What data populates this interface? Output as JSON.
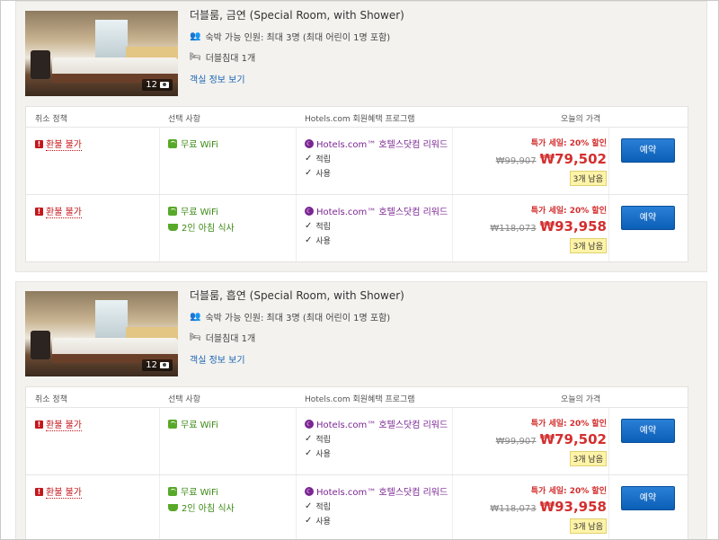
{
  "rooms": [
    {
      "title": "더블룸, 금연 (Special Room, with Shower)",
      "occupancy": "숙박 가능 인원: 최대 3명 (최대 어린이 1명 포함)",
      "bed": "더블침대 1개",
      "details_link": "객실 정보 보기",
      "photo_count": "12",
      "headers": {
        "policy": "취소 정책",
        "choices": "선택 사항",
        "program": "Hotels.com 회원혜택 프로그램",
        "price": "오늘의 가격"
      },
      "rates": [
        {
          "policy": "환불 불가",
          "choices": [
            "무료 WiFi"
          ],
          "program": "Hotels.com™ 호텔스닷컴 리워드",
          "checks": [
            "적립",
            "사용"
          ],
          "sale": "특가 세일: 20% 할인",
          "old_price": "₩99,907",
          "new_price": "₩79,502",
          "left": "3개 남음",
          "book": "예약"
        },
        {
          "policy": "환불 불가",
          "choices": [
            "무료 WiFi",
            "2인 아침 식사"
          ],
          "program": "Hotels.com™ 호텔스닷컴 리워드",
          "checks": [
            "적립",
            "사용"
          ],
          "sale": "특가 세일: 20% 할인",
          "old_price": "₩118,073",
          "new_price": "₩93,958",
          "left": "3개 남음",
          "book": "예약"
        }
      ]
    },
    {
      "title": "더블룸, 흡연 (Special Room, with Shower)",
      "occupancy": "숙박 가능 인원: 최대 3명 (최대 어린이 1명 포함)",
      "bed": "더블침대 1개",
      "details_link": "객실 정보 보기",
      "photo_count": "12",
      "headers": {
        "policy": "취소 정책",
        "choices": "선택 사항",
        "program": "Hotels.com 회원혜택 프로그램",
        "price": "오늘의 가격"
      },
      "rates": [
        {
          "policy": "환불 불가",
          "choices": [
            "무료 WiFi"
          ],
          "program": "Hotels.com™ 호텔스닷컴 리워드",
          "checks": [
            "적립",
            "사용"
          ],
          "sale": "특가 세일: 20% 할인",
          "old_price": "₩99,907",
          "new_price": "₩79,502",
          "left": "3개 남음",
          "book": "예약"
        },
        {
          "policy": "환불 불가",
          "choices": [
            "무료 WiFi",
            "2인 아침 식사"
          ],
          "program": "Hotels.com™ 호텔스닷컴 리워드",
          "checks": [
            "적립",
            "사용"
          ],
          "sale": "특가 세일: 20% 할인",
          "old_price": "₩118,073",
          "new_price": "₩93,958",
          "left": "3개 남음",
          "book": "예약"
        }
      ]
    }
  ]
}
